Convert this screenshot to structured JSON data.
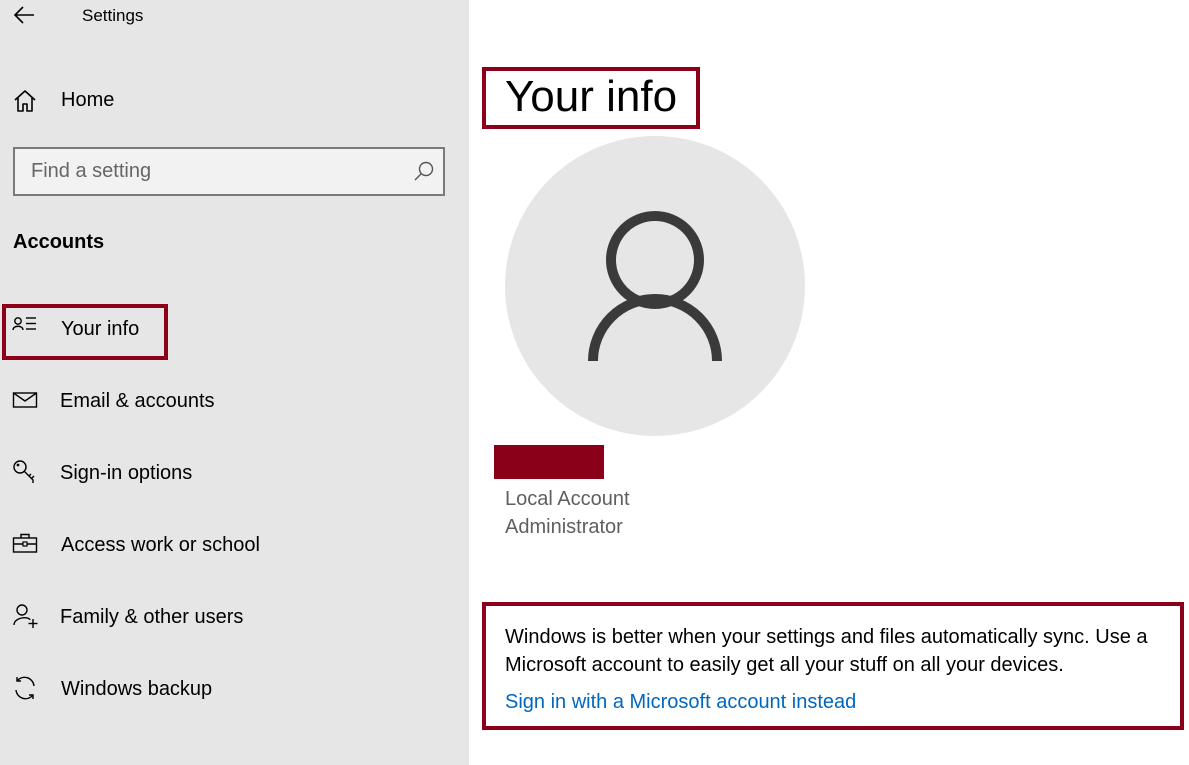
{
  "app": {
    "title": "Settings"
  },
  "sidebar": {
    "home_label": "Home",
    "search_placeholder": "Find a setting",
    "section_heading": "Accounts",
    "items": [
      {
        "label": "Your info",
        "icon": "contact-card-icon",
        "selected": true
      },
      {
        "label": "Email & accounts",
        "icon": "mail-icon"
      },
      {
        "label": "Sign-in options",
        "icon": "key-icon"
      },
      {
        "label": "Access work or school",
        "icon": "briefcase-icon"
      },
      {
        "label": "Family & other users",
        "icon": "add-person-icon"
      },
      {
        "label": "Windows backup",
        "icon": "sync-icon"
      }
    ]
  },
  "main": {
    "title": "Your info",
    "account_type": "Local Account",
    "account_role": "Administrator",
    "promo_text": "Windows is better when your settings and files automatically sync. Use a Microsoft account to easily get all your stuff on all your devices.",
    "link_text": "Sign in with a Microsoft account instead"
  },
  "colors": {
    "highlight": "#8b0018",
    "link": "#0067c0",
    "sidebar_bg": "#e6e6e6"
  }
}
